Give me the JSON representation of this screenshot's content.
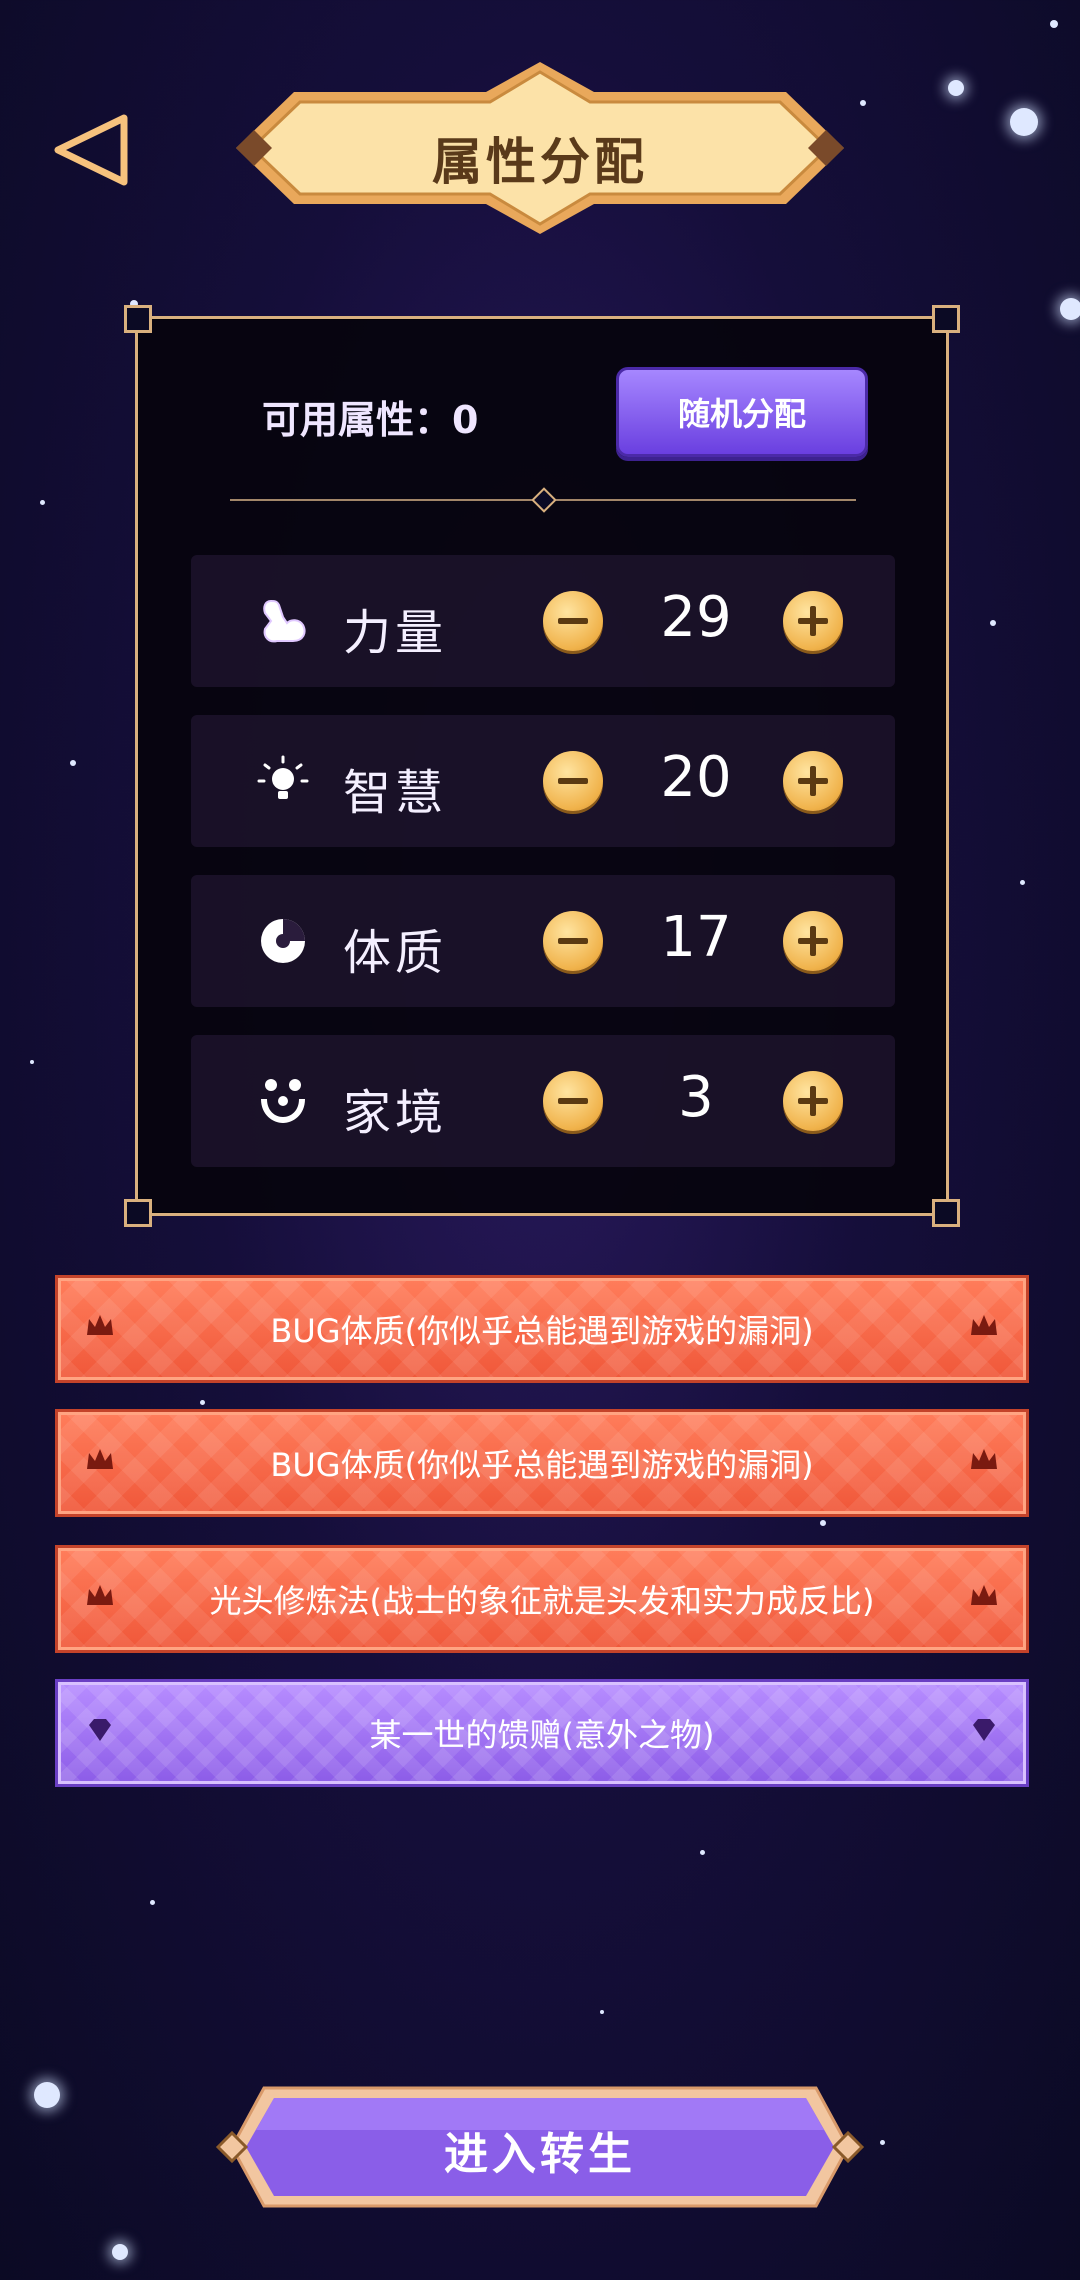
{
  "header": {
    "title": "属性分配"
  },
  "panel": {
    "points_label": "可用属性：0",
    "random_button": "随机分配",
    "stats": [
      {
        "label": "力量",
        "value": "29",
        "icon": "muscle-icon"
      },
      {
        "label": "智慧",
        "value": "20",
        "icon": "lightbulb-icon"
      },
      {
        "label": "体质",
        "value": "17",
        "icon": "pie-chart-icon"
      },
      {
        "label": "家境",
        "value": "3",
        "icon": "family-icon"
      }
    ]
  },
  "traits": [
    {
      "text": "BUG体质(你似乎总能遇到游戏的漏洞)",
      "rarity": "red",
      "icon": "crown-icon"
    },
    {
      "text": "BUG体质(你似乎总能遇到游戏的漏洞)",
      "rarity": "red",
      "icon": "crown-icon"
    },
    {
      "text": "光头修炼法(战士的象征就是头发和实力成反比)",
      "rarity": "red",
      "icon": "crown-icon"
    },
    {
      "text": "某一世的馈赠(意外之物)",
      "rarity": "purple",
      "icon": "diamond-icon"
    }
  ],
  "enter_button": "进入转生",
  "colors": {
    "gold": "#f6c27d",
    "red_trait": "#f0583a",
    "purple_trait": "#8d5de8",
    "button_purple": "#6a3fe0"
  }
}
